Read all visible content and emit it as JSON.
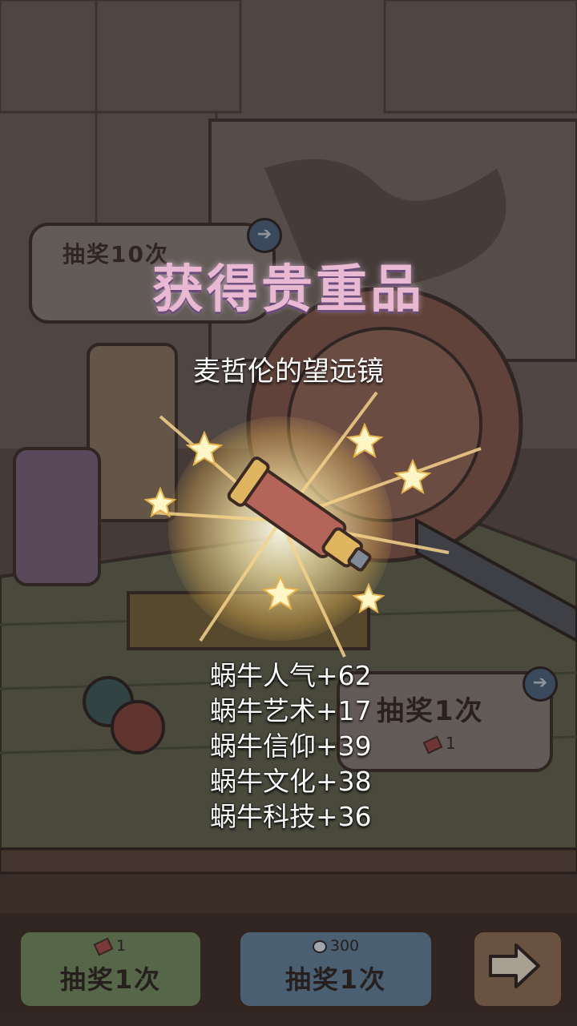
{
  "background": {
    "draw_ten_label": "抽奖10次",
    "draw_once_card": {
      "label": "抽奖1次",
      "cost": "1"
    }
  },
  "reward": {
    "title": "获得贵重品",
    "item_name": "麦哲伦的望远镜",
    "item_icon": "telescope-icon",
    "stats": [
      "蜗牛人气+62",
      "蜗牛艺术+17",
      "蜗牛信仰+39",
      "蜗牛文化+38",
      "蜗牛科技+36"
    ]
  },
  "bottom_bar": {
    "ticket_draw": {
      "cost": "1",
      "label": "抽奖1次"
    },
    "bubble_draw": {
      "cost": "300",
      "label": "抽奖1次"
    },
    "next_icon": "arrow-right-icon"
  },
  "colors": {
    "title_gradient": "#e9b9d4",
    "green_button": "#6d8a5e",
    "blue_button": "#5d7f98"
  }
}
